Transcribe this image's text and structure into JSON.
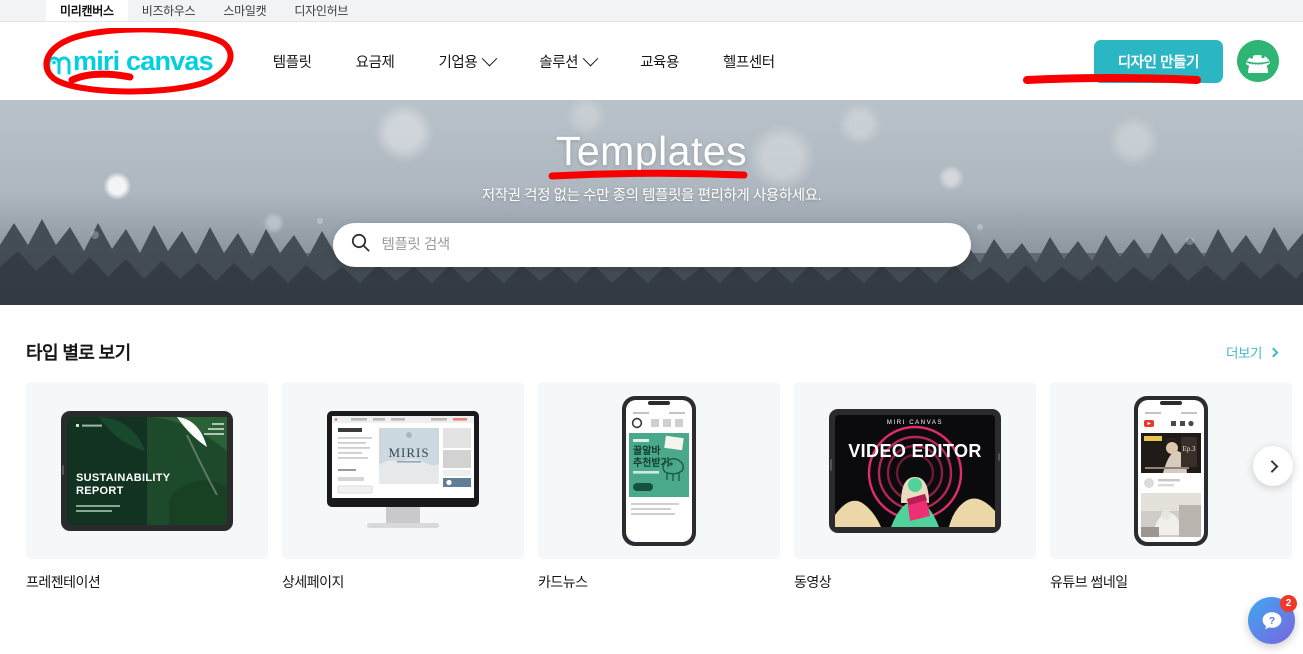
{
  "topbar": {
    "tabs": [
      {
        "label": "미리캔버스",
        "active": true
      },
      {
        "label": "비즈하우스",
        "active": false
      },
      {
        "label": "스마일캣",
        "active": false
      },
      {
        "label": "디자인허브",
        "active": false
      }
    ]
  },
  "header": {
    "logo_text": "miri canvas",
    "logo_color": "#00cfe0",
    "nav": [
      {
        "label": "템플릿",
        "has_dropdown": false
      },
      {
        "label": "요금제",
        "has_dropdown": false
      },
      {
        "label": "기업용",
        "has_dropdown": true
      },
      {
        "label": "솔루션",
        "has_dropdown": true
      },
      {
        "label": "교육용",
        "has_dropdown": false
      },
      {
        "label": "헬프센터",
        "has_dropdown": false
      }
    ],
    "cta_label": "디자인 만들기",
    "cta_color": "#2bb6c4",
    "avatar_color": "#2fb573"
  },
  "hero": {
    "title": "Templates",
    "subtitle": "저작권 걱정 없는 수만 종의 템플릿을 편리하게 사용하세요.",
    "search_placeholder": "템플릿 검색",
    "search_value": "",
    "search_icon": "search-icon"
  },
  "section": {
    "title": "타입 별로 보기",
    "more_label": "더보기",
    "more_color": "#46b6cf",
    "cards": [
      {
        "label": "프레젠테이션",
        "thumb": "presentation"
      },
      {
        "label": "상세페이지",
        "thumb": "detail-page"
      },
      {
        "label": "카드뉴스",
        "thumb": "card-news"
      },
      {
        "label": "동영상",
        "thumb": "video"
      },
      {
        "label": "유튜브 썸네일",
        "thumb": "youtube-thumbnail"
      }
    ],
    "thumb_text": {
      "presentation_line1": "SUSTAINABILITY",
      "presentation_line2": "REPORT",
      "detail_brand": "MIRIS",
      "detail_sub": "SOFA",
      "cardnews_line1": "꿀알바",
      "cardnews_line2": "추천받기",
      "video_brand": "MIRI CANVAS",
      "video_title": "VIDEO EDITOR"
    }
  },
  "fab": {
    "icon": "question-chat-icon",
    "badge": "2",
    "badge_color": "#f0392b"
  },
  "annotations": {
    "color": "#f90000",
    "items": [
      {
        "name": "logo-circle",
        "shape": "ellipse"
      },
      {
        "name": "cta-underline",
        "shape": "line"
      },
      {
        "name": "hero-title-underline",
        "shape": "line"
      }
    ]
  }
}
